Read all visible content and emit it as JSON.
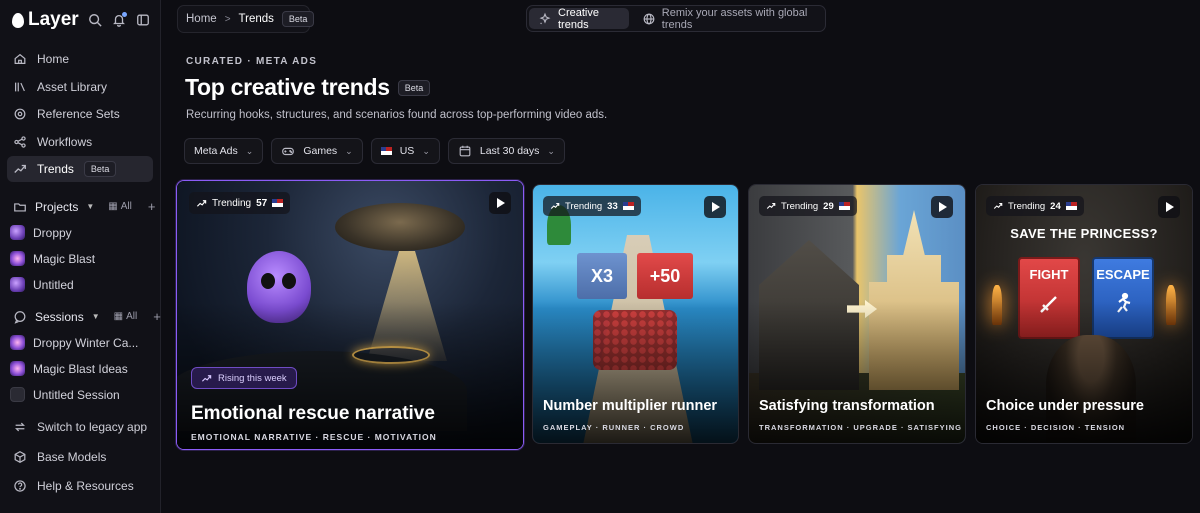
{
  "app": {
    "name": "Layer"
  },
  "sidebar": {
    "nav": [
      {
        "label": "Home",
        "icon": "home-icon"
      },
      {
        "label": "Asset Library",
        "icon": "library-icon"
      },
      {
        "label": "Reference Sets",
        "icon": "target-icon"
      },
      {
        "label": "Workflows",
        "icon": "share-nodes-icon"
      },
      {
        "label": "Trends",
        "icon": "trend-up-icon",
        "badge": "Beta",
        "active": true
      }
    ],
    "projects": {
      "label": "Projects",
      "all_label": "All",
      "items": [
        {
          "label": "Droppy"
        },
        {
          "label": "Magic Blast"
        },
        {
          "label": "Untitled"
        }
      ]
    },
    "sessions": {
      "label": "Sessions",
      "all_label": "All",
      "items": [
        {
          "label": "Droppy Winter Ca..."
        },
        {
          "label": "Magic Blast Ideas"
        },
        {
          "label": "Untitled Session"
        }
      ]
    },
    "bottom": [
      {
        "label": "Switch to legacy app",
        "icon": "switch-icon"
      },
      {
        "label": "Base Models",
        "icon": "cube-icon"
      },
      {
        "label": "Help & Resources",
        "icon": "help-icon"
      }
    ]
  },
  "topbar": {
    "breadcrumb": {
      "home": "Home",
      "current": "Trends",
      "badge": "Beta"
    },
    "modes": [
      {
        "label": "Creative trends",
        "active": true
      },
      {
        "label": "Remix your assets with global trends",
        "active": false
      }
    ]
  },
  "header": {
    "eyebrow": "CURATED · META ADS",
    "title": "Top creative trends",
    "title_badge": "Beta",
    "subtitle": "Recurring hooks, structures, and scenarios found across top-performing video ads."
  },
  "filters": [
    {
      "label": "Meta Ads"
    },
    {
      "label": "Games"
    },
    {
      "label": "US"
    },
    {
      "label": "Last 30 days"
    }
  ],
  "cards": [
    {
      "trend_label": "Trending",
      "trend_value": "57",
      "badge": "Rising this week",
      "title": "Emotional rescue narrative",
      "tags": "EMOTIONAL NARRATIVE · RESCUE · MOTIVATION"
    },
    {
      "trend_label": "Trending",
      "trend_value": "33",
      "title": "Number multiplier runner",
      "tags": "GAMEPLAY · RUNNER · CROWD",
      "gate_left": "X3",
      "gate_right": "+50"
    },
    {
      "trend_label": "Trending",
      "trend_value": "29",
      "title": "Satisfying transformation",
      "tags": "TRANSFORMATION · UPGRADE · SATISFYING"
    },
    {
      "trend_label": "Trending",
      "trend_value": "24",
      "title": "Choice under pressure",
      "tags": "CHOICE · DECISION · TENSION",
      "art_heading": "SAVE THE PRINCESS?",
      "art_option_a": "FIGHT",
      "art_option_b": "ESCAPE"
    }
  ]
}
